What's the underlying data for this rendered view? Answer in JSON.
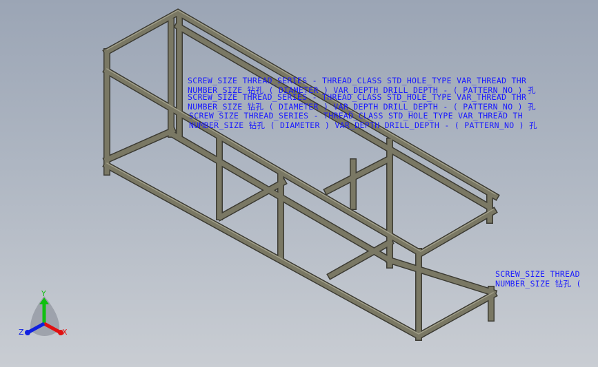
{
  "annotations": [
    {
      "line1": "SCREW_SIZE THREAD_SERIES - THREAD_CLASS STD_HOLE_TYPE VAR_THREAD THR",
      "line2": "NUMBER_SIZE 钻孔 ( DIAMETER ) VAR_DEPTH DRILL_DEPTH - ( PATTERN_NO ) 孔"
    },
    {
      "line1": "SCREW_SIZE THREAD_SERIES - THREAD_CLASS STD_HOLE_TYPE VAR_THREAD THR",
      "line2": "NUMBER_SIZE 钻孔 ( DIAMETER ) VAR_DEPTH DRILL_DEPTH - ( PATTERN_NO ) 孔"
    },
    {
      "line1": "SCREW_SIZE THREAD_SERIES - THREAD_CLASS STD_HOLE_TYPE VAR_THREAD TH",
      "line2": "NUMBER_SIZE 钻孔 ( DIAMETER ) VAR_DEPTH DRILL_DEPTH - ( PATTERN_NO ) 孔"
    },
    {
      "line1": "SCREW_SIZE THREAD",
      "line2": "NUMBER_SIZE 钻孔 ("
    }
  ],
  "triad": {
    "x_label": "X",
    "y_label": "Y",
    "z_label": "Z"
  },
  "colors": {
    "annotation": "#1a1aff",
    "frame": "#75735f",
    "x_axis": "#e01010",
    "y_axis": "#10c010",
    "z_axis": "#1020e0"
  }
}
